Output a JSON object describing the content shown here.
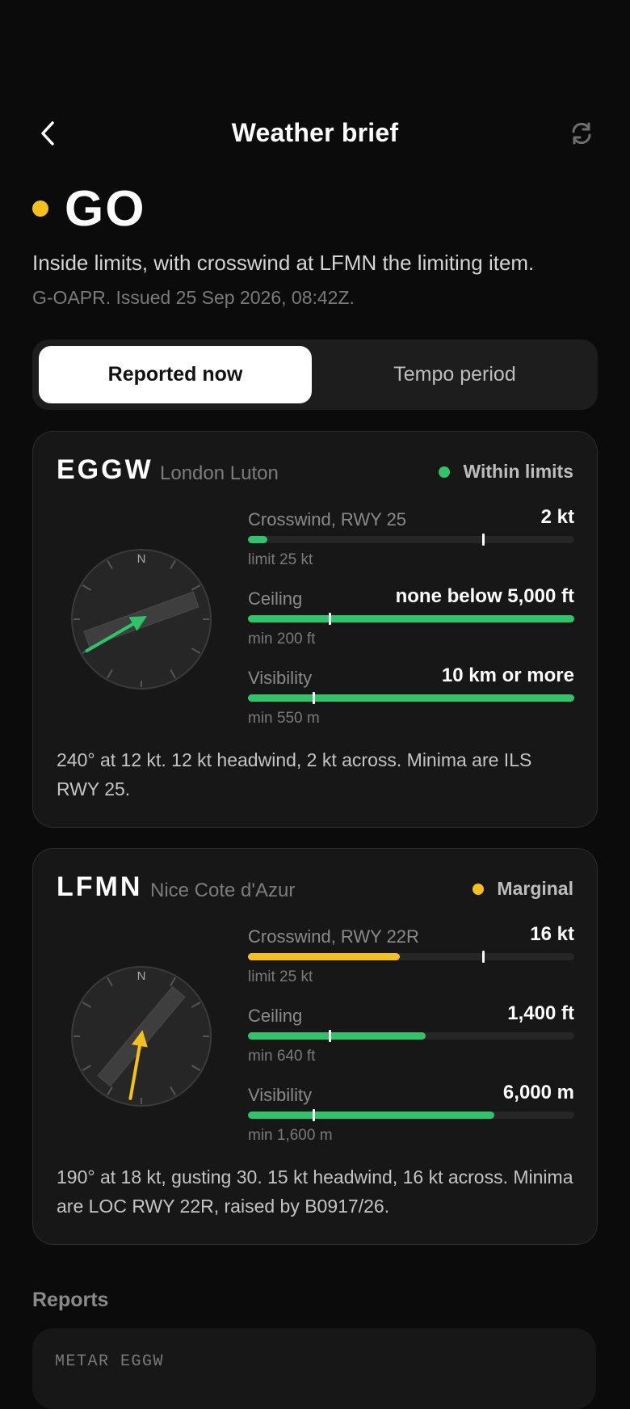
{
  "header": {
    "title": "Weather brief"
  },
  "verdict": {
    "word": "GO",
    "color": "#f4c01e",
    "summary": "Inside limits, with crosswind at LFMN the limiting item.",
    "issued": "G-OAPR. Issued 25 Sep 2026, 08:42Z."
  },
  "tabs": {
    "active": "Reported now",
    "inactive": "Tempo period"
  },
  "airports": [
    {
      "icao": "EGGW",
      "name": "London Luton",
      "status": "Within limits",
      "status_color": "#2ec46a",
      "compass_label": "N",
      "runway_heading_deg": 250,
      "wind_from_deg": 240,
      "arrow_color": "#2ec46a",
      "crosswind": {
        "label": "Crosswind, RWY 25",
        "value": "2 kt",
        "sub": "limit 25 kt",
        "fill_fraction": 0.06,
        "limit_fraction": 0.72,
        "color": "#2ec46a"
      },
      "ceiling": {
        "label": "Ceiling",
        "value": "none below 5,000 ft",
        "sub": "min 200 ft",
        "fill_fraction": 1.0,
        "limit_fraction": 0.25,
        "color": "#2ec46a"
      },
      "visibility": {
        "label": "Visibility",
        "value": "10 km or more",
        "sub": "min 550 m",
        "fill_fraction": 1.0,
        "limit_fraction": 0.2,
        "color": "#2ec46a"
      },
      "note": "240° at 12 kt. 12 kt headwind, 2 kt across. Minima are ILS RWY 25."
    },
    {
      "icao": "LFMN",
      "name": "Nice Cote d'Azur",
      "status": "Marginal",
      "status_color": "#f4c01e",
      "compass_label": "N",
      "runway_heading_deg": 220,
      "wind_from_deg": 190,
      "arrow_color": "#f4c01e",
      "crosswind": {
        "label": "Crosswind, RWY 22R",
        "value": "16 kt",
        "sub": "limit 25 kt",
        "fill_fraction": 0.465,
        "limit_fraction": 0.72,
        "color": "#f4c01e"
      },
      "ceiling": {
        "label": "Ceiling",
        "value": "1,400 ft",
        "sub": "min 640 ft",
        "fill_fraction": 0.545,
        "limit_fraction": 0.25,
        "color": "#2ec46a"
      },
      "visibility": {
        "label": "Visibility",
        "value": "6,000 m",
        "sub": "min 1,600 m",
        "fill_fraction": 0.755,
        "limit_fraction": 0.2,
        "color": "#2ec46a"
      },
      "note": "190° at 18 kt, gusting 30. 15 kt headwind, 16 kt across. Minima are LOC RWY 22R, raised by B0917/26."
    }
  ],
  "reports": {
    "title": "Reports",
    "first_label": "METAR EGGW"
  }
}
